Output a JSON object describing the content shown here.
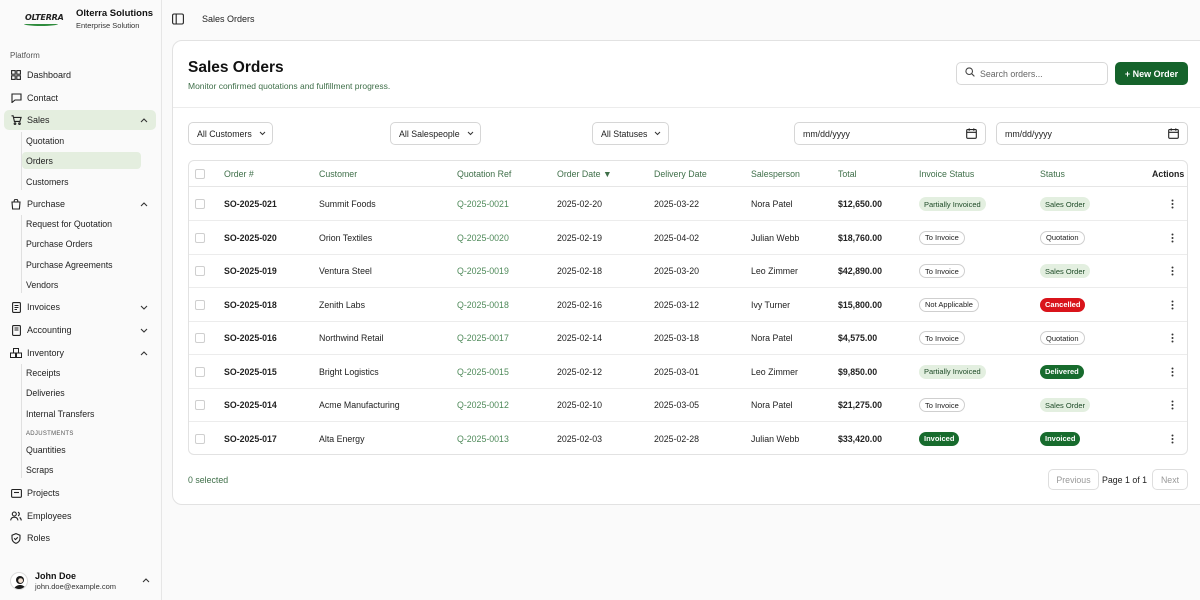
{
  "brand": {
    "logo_text": "OLTERRA",
    "name": "Olterra Solutions",
    "subtitle": "Enterprise Solution"
  },
  "sidebar": {
    "section_label": "Platform",
    "dashboard": "Dashboard",
    "contact": "Contact",
    "sales": {
      "label": "Sales",
      "items": [
        "Quotation",
        "Orders",
        "Customers"
      ]
    },
    "purchase": {
      "label": "Purchase",
      "items": [
        "Request for Quotation",
        "Purchase Orders",
        "Purchase Agreements",
        "Vendors"
      ]
    },
    "invoices": "Invoices",
    "accounting": "Accounting",
    "inventory": {
      "label": "Inventory",
      "items": [
        "Receipts",
        "Deliveries",
        "Internal Transfers"
      ],
      "caption": "ADJUSTMENTS",
      "adjustments": [
        "Quantities",
        "Scraps"
      ]
    },
    "projects": "Projects",
    "employees": "Employees",
    "roles": "Roles"
  },
  "user": {
    "name": "John Doe",
    "email": "john.doe@example.com"
  },
  "breadcrumb": "Sales Orders",
  "page": {
    "title": "Sales Orders",
    "subtitle": "Monitor confirmed quotations and fulfillment progress.",
    "search_placeholder": "Search orders...",
    "new_button": "+ New Order"
  },
  "filters": {
    "customers": "All Customers",
    "salespeople": "All Salespeople",
    "statuses": "All Statuses",
    "date_from": "mm/dd/yyyy",
    "date_to": "mm/dd/yyyy"
  },
  "table": {
    "headers": {
      "order": "Order #",
      "customer": "Customer",
      "quotation": "Quotation Ref",
      "order_date": "Order Date ▼",
      "delivery_date": "Delivery Date",
      "salesperson": "Salesperson",
      "total": "Total",
      "invoice_status": "Invoice Status",
      "status": "Status",
      "actions": "Actions"
    },
    "rows": [
      {
        "order": "SO-2025-021",
        "customer": "Summit Foods",
        "quotation": "Q-2025-0021",
        "order_date": "2025-02-20",
        "delivery_date": "2025-03-22",
        "salesperson": "Nora Patel",
        "total": "$12,650.00",
        "invoice_status": "Partially Invoiced",
        "status": "Sales Order"
      },
      {
        "order": "SO-2025-020",
        "customer": "Orion Textiles",
        "quotation": "Q-2025-0020",
        "order_date": "2025-02-19",
        "delivery_date": "2025-04-02",
        "salesperson": "Julian Webb",
        "total": "$18,760.00",
        "invoice_status": "To Invoice",
        "status": "Quotation"
      },
      {
        "order": "SO-2025-019",
        "customer": "Ventura Steel",
        "quotation": "Q-2025-0019",
        "order_date": "2025-02-18",
        "delivery_date": "2025-03-20",
        "salesperson": "Leo Zimmer",
        "total": "$42,890.00",
        "invoice_status": "To Invoice",
        "status": "Sales Order"
      },
      {
        "order": "SO-2025-018",
        "customer": "Zenith Labs",
        "quotation": "Q-2025-0018",
        "order_date": "2025-02-16",
        "delivery_date": "2025-03-12",
        "salesperson": "Ivy Turner",
        "total": "$15,800.00",
        "invoice_status": "Not Applicable",
        "status": "Cancelled"
      },
      {
        "order": "SO-2025-016",
        "customer": "Northwind Retail",
        "quotation": "Q-2025-0017",
        "order_date": "2025-02-14",
        "delivery_date": "2025-03-18",
        "salesperson": "Nora Patel",
        "total": "$4,575.00",
        "invoice_status": "To Invoice",
        "status": "Quotation"
      },
      {
        "order": "SO-2025-015",
        "customer": "Bright Logistics",
        "quotation": "Q-2025-0015",
        "order_date": "2025-02-12",
        "delivery_date": "2025-03-01",
        "salesperson": "Leo Zimmer",
        "total": "$9,850.00",
        "invoice_status": "Partially Invoiced",
        "status": "Delivered"
      },
      {
        "order": "SO-2025-014",
        "customer": "Acme Manufacturing",
        "quotation": "Q-2025-0012",
        "order_date": "2025-02-10",
        "delivery_date": "2025-03-05",
        "salesperson": "Nora Patel",
        "total": "$21,275.00",
        "invoice_status": "To Invoice",
        "status": "Sales Order"
      },
      {
        "order": "SO-2025-017",
        "customer": "Alta Energy",
        "quotation": "Q-2025-0013",
        "order_date": "2025-02-03",
        "delivery_date": "2025-02-28",
        "salesperson": "Julian Webb",
        "total": "$33,420.00",
        "invoice_status": "Invoiced",
        "status": "Invoiced"
      }
    ]
  },
  "footer": {
    "selected": "0 selected",
    "previous": "Previous",
    "page": "Page 1 of 1",
    "next": "Next"
  },
  "colors": {
    "accent": "#15632b",
    "soft_badge": "#e3efe0",
    "cancelled": "#d9141b",
    "muted_text": "#3f6f49"
  }
}
